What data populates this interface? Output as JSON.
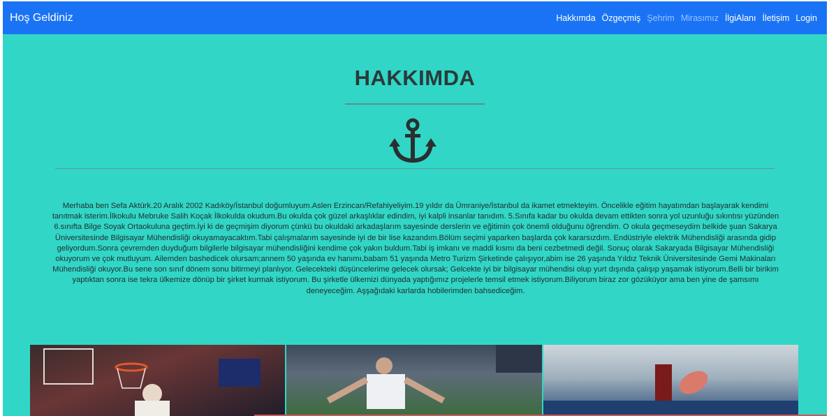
{
  "navbar": {
    "brand": "Hoş Geldiniz",
    "links": [
      "Hakkımda",
      "Özgeçmiş",
      "Şehrim",
      "Mirasımız",
      "İlgiAlanı",
      "İletişim",
      "Login"
    ],
    "dim_links": [
      "Şehrim",
      "Mirasımız"
    ]
  },
  "section": {
    "title": "HAKKIMDA",
    "icon": "anchor-icon",
    "paragraph": "Merhaba ben Sefa Aktürk.20 Aralık 2002 Kadıköy/İstanbul doğumluyum.Aslen Erzincan/Refahiyeliyim.19 yıldır da Ümraniye/İstanbul da ikamet etmekteyim. Öncelikle eğitim hayatımdan başlayarak kendimi tanıtmak isterim.İlkokulu Mebruke Salih Koçak İlkokulda okudum.Bu okulda çok güzel arkaşlıklar edindim, iyi kalpli insanlar tanıdım. 5.Sınıfa kadar bu okulda devam ettikten sonra yol uzunluğu sıkıntısı yüzünden 6.sınıfta Bilge Soyak Ortaokuluna geçtim.İyi ki de geçmişim diyorum çünkü bu okuldaki arkadaşlarım sayesinde derslerin ve eğitimin çok önemli olduğunu öğrendim. O okula geçmeseydim belkide şuan Sakarya Üniversitesinde Bilgisayar Mühendisliği okuyamayacaktım.Tabi çalışmalarım sayesinde iyi de bir lise kazandım.Bölüm seçimi yaparken başlarda çok kararsızdım. Endüstriyle elektrik Mühendisliği arasında gidip geliyordum.Sonra çevremden duyduğum bilgilerle bilgisayar mühendisliğini kendime çok yakın buldum.Tabi iş imkanı ve maddi kısmı da beni cezbetmedi değil. Sonuç olarak Sakaryada Bilgisayar Mühendisliği okuyorum ve çok mutluyum. Ailemden bashedicek olursam;annem 50 yaşında ev hanımı,babam 51 yaşında Metro Turizm Şirketinde çalışıyor,abim ise 26 yaşında Yıldız Teknik Üniversitesinde Gemi Makinaları Mühendisliği okuyor.Bu sene son sınıf dönem sonu bitirmeyi planlıyor. Gelecekteki düşüncelerime gelecek olursak; Gelcekte iyi bir bilgisayar mühendisi olup yurt dışında çalışıp yaşamak istiyorum.Belli bir birikim yaptıktan sonra ise tekra ülkemize dönüp bir şirket kurmak istiyorum. Bu şirketle ülkemizi dünyada yaptığımız projelerle temsil etmek istiyorum.Biliyorum biraz zor gözüküyor ama ben yine de şamsımı deneyeceğim. Aşşağıdaki karlarda hobilerimden bahsediceğim."
  },
  "gallery": {
    "photos": [
      "basketball-photo",
      "football-photo",
      "table-tennis-photo"
    ]
  },
  "colors": {
    "navbar_bg": "#1a73f5",
    "page_bg": "#31d6c6",
    "text": "#2a3a3a"
  }
}
